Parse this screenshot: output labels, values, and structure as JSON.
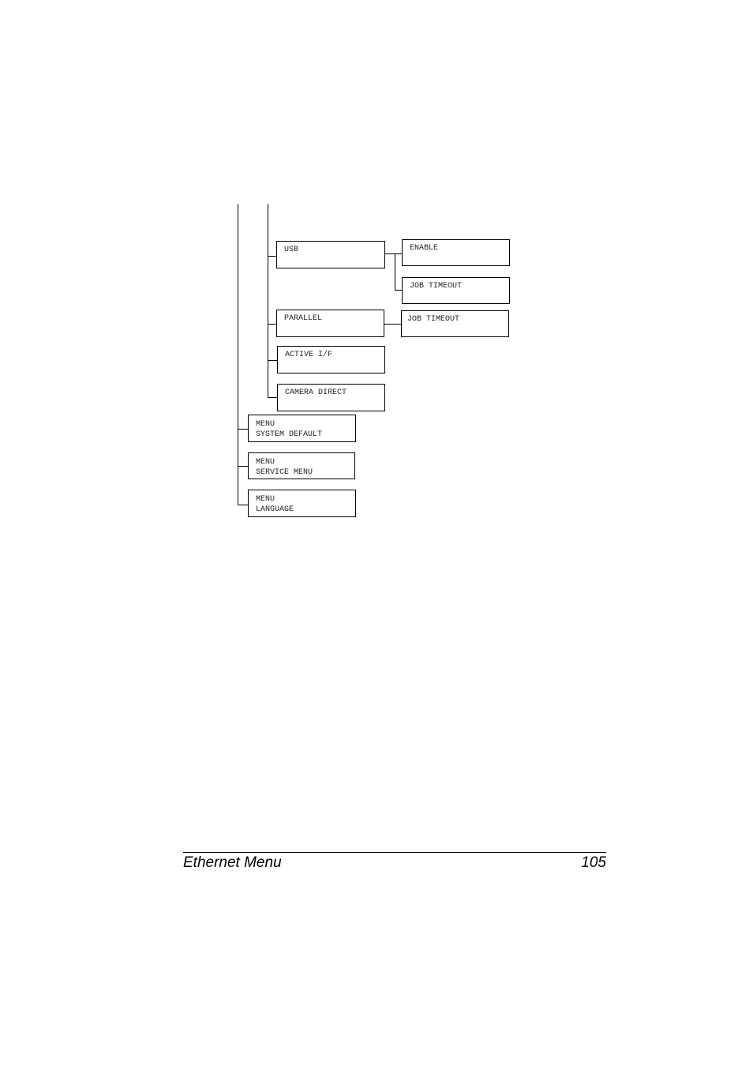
{
  "diagram": {
    "nodes": {
      "usb": "USB",
      "usb_enable": "ENABLE",
      "usb_job_timeout": "JOB TIMEOUT",
      "parallel": "PARALLEL",
      "parallel_job_timeout": "JOB TIMEOUT",
      "active_if": "ACTIVE I/F",
      "camera_direct": "CAMERA DIRECT",
      "system_default": "MENU\nSYSTEM DEFAULT",
      "service_menu": "MENU\nSERVICE MENU",
      "language": "MENU\nLANGUAGE"
    },
    "edges": [
      [
        "usb",
        "usb_enable"
      ],
      [
        "usb",
        "usb_job_timeout"
      ],
      [
        "parallel",
        "parallel_job_timeout"
      ]
    ]
  },
  "footer": {
    "section_title": "Ethernet Menu",
    "page_number": "105"
  }
}
